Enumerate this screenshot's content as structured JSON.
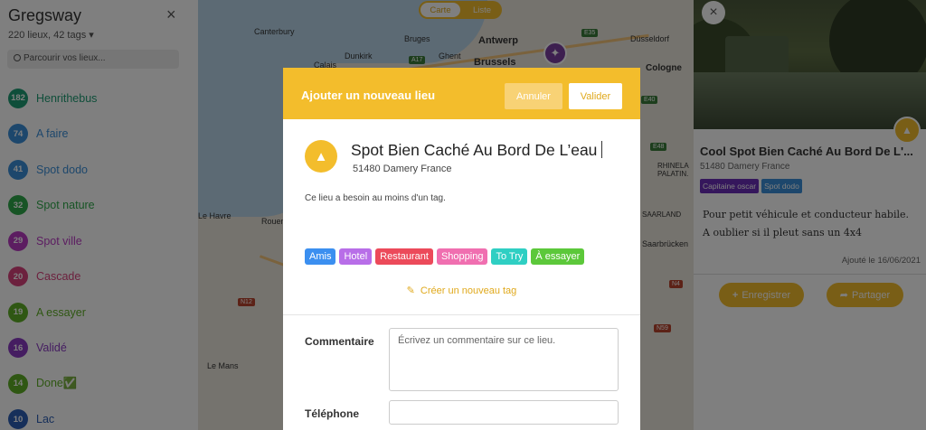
{
  "sidebar": {
    "title": "Gregsway",
    "close_icon": "×",
    "subtitle": "220 lieux, 42 tags ▾",
    "search_placeholder": "Parcourir vos lieux...",
    "items": [
      {
        "count": "182",
        "label": "Henrithebus",
        "color": "#1f9d74"
      },
      {
        "count": "74",
        "label": "A faire",
        "color": "#3b8fd8"
      },
      {
        "count": "41",
        "label": "Spot dodo",
        "color": "#3b8fd8"
      },
      {
        "count": "32",
        "label": "Spot nature",
        "color": "#2fa94a"
      },
      {
        "count": "29",
        "label": "Spot ville",
        "color": "#b83ac2"
      },
      {
        "count": "20",
        "label": "Cascade",
        "color": "#d9437d"
      },
      {
        "count": "19",
        "label": "A essayer",
        "color": "#5fae26"
      },
      {
        "count": "16",
        "label": "Validé",
        "color": "#8a3ac2"
      },
      {
        "count": "14",
        "label": "Done✅",
        "color": "#5fae26"
      },
      {
        "count": "10",
        "label": "Lac",
        "color": "#2d5fb5"
      }
    ]
  },
  "map": {
    "toggle": {
      "map": "Carte",
      "list": "Liste"
    },
    "cities": [
      "Canterbury",
      "Bruges",
      "Antwerp",
      "Düsseldorf",
      "Dunkirk",
      "Ghent",
      "Calais",
      "Brussels",
      "Cologne",
      "Rouen",
      "Le Havre",
      "Le Mans",
      "RHINELA PALATIN.",
      "SAARLAND",
      "Saarbrücken"
    ],
    "roads": [
      "A17",
      "E35",
      "E40",
      "E48",
      "N12",
      "N4",
      "N59"
    ]
  },
  "modal": {
    "title": "Ajouter un nouveau lieu",
    "cancel": "Annuler",
    "validate": "Valider",
    "place_name": "Spot Bien Caché Au Bord De L’eau",
    "address": "51480 Damery France",
    "warning": "Ce lieu a besoin au moins d'un tag.",
    "tags": [
      {
        "label": "Amis",
        "color": "#3b8ff0"
      },
      {
        "label": "Hotel",
        "color": "#b86ee8"
      },
      {
        "label": "Restaurant",
        "color": "#ec4a5a"
      },
      {
        "label": "Shopping",
        "color": "#f06fb0"
      },
      {
        "label": "To Try",
        "color": "#2fcfc3"
      },
      {
        "label": "À essayer",
        "color": "#5cc83a"
      }
    ],
    "new_tag": "Créer un nouveau tag",
    "comment_label": "Commentaire",
    "comment_placeholder": "Écrivez un commentaire sur ce lieu.",
    "phone_label": "Téléphone"
  },
  "place_panel": {
    "title": "Cool Spot Bien Caché Au Bord De L'...",
    "address": "51480 Damery France",
    "tags": [
      {
        "label": "Capitaine oscar",
        "color": "#6a2fb8"
      },
      {
        "label": "Spot dodo",
        "color": "#3b8fd8"
      }
    ],
    "description": "Pour petit véhicule et conducteur habile. A oublier si il pleut sans un 4x4",
    "date": "Ajouté le 16/06/2021",
    "save_button": "Enregistrer",
    "share_button": "Partager"
  },
  "colors": {
    "accent": "#f3bd2c",
    "overlay": "rgba(0,0,0,0.5)"
  }
}
